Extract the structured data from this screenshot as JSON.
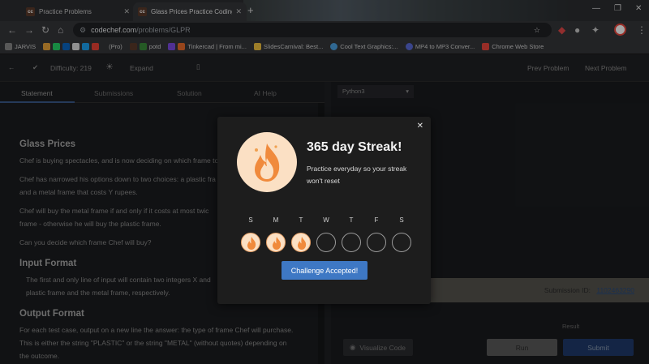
{
  "browser": {
    "tabs": [
      {
        "favicon": "cc",
        "title": "Practice Problems",
        "close": "✕"
      },
      {
        "favicon": "cc",
        "title": "Glass Prices Practice Coding Pr",
        "close": "✕"
      }
    ],
    "new_tab": "+",
    "url_host": "codechef.com",
    "url_path": "/problems/GLPR",
    "bookmarks": [
      "JARVIS",
      "(Pro)",
      "potd",
      "Tinkercad | From mi...",
      "SlidesCarnival: Best...",
      "Cool Text Graphics:...",
      "MP4 to MP3 Conver...",
      "Chrome Web Store"
    ],
    "accent_colors": {
      "cc_favicon": "#5a3a2a",
      "url_bar": "#202124"
    }
  },
  "app": {
    "difficulty_label": "Difficulty: 219",
    "expand_label": "Expand",
    "prev_label": "Prev Problem",
    "next_label": "Next Problem",
    "left_tabs": [
      "Statement",
      "Submissions",
      "Solution",
      "AI Help"
    ],
    "language": "Python3",
    "statement": {
      "title": "Glass Prices",
      "p1": "Chef is buying spectacles, and is now deciding on which frame to",
      "p2a": "Chef has narrowed his options down to two choices: a plastic fra",
      "p2b": "and a metal frame that costs Y rupees.",
      "p3a": "Chef will buy the metal frame if and only if it costs at most twic",
      "p3b": "frame - otherwise he will buy the plastic frame.",
      "p4": "Can you decide which frame Chef will buy?",
      "input_heading": "Input Format",
      "input_a": "The first and only line of input will contain two integers X and",
      "input_b": "plastic frame and the metal frame, respectively.",
      "output_heading": "Output Format",
      "output_a": "For each test case, output on a new line the answer: the type of frame Chef will purchase.",
      "output_b": "This is either the string \"PLASTIC\" or the string \"METAL\" (without quotes) depending on",
      "output_c": "the outcome."
    },
    "submission_id_label": "Submission ID:",
    "submission_id": "1102463290",
    "result_label": "Result",
    "visualize_label": "Visualize Code",
    "run_label": "Run",
    "submit_label": "Submit"
  },
  "modal": {
    "close": "✕",
    "title": "365 day Streak!",
    "subtitle": "Practice everyday so your streak won't reset",
    "days": [
      "S",
      "M",
      "T",
      "W",
      "T",
      "F",
      "S"
    ],
    "completed_days": 3,
    "button_label": "Challenge Accepted!"
  }
}
